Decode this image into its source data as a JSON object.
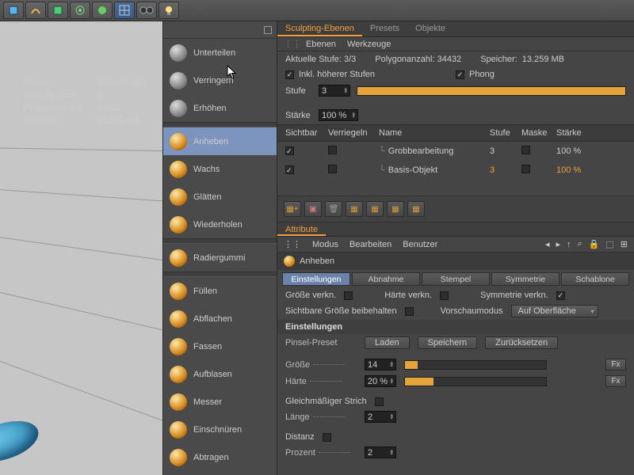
{
  "topbar_icons": [
    "cube",
    "curl",
    "cube2",
    "atom",
    "bulb-g",
    "grid",
    "goggles",
    "bulb"
  ],
  "viewport_info": {
    "rows": [
      {
        "k": "Ebene",
        "v": "Basis-Objekt"
      },
      {
        "k": "Aktuelle Stufe",
        "v": "3"
      },
      {
        "k": "Polygonanzahl",
        "v": "34432"
      },
      {
        "k": "Speicher",
        "v": "13.259 MB"
      }
    ]
  },
  "palette": {
    "groups": [
      [
        {
          "label": "Unterteilen",
          "icon": "gray"
        },
        {
          "label": "Verringern",
          "icon": "gray"
        },
        {
          "label": "Erhöhen",
          "icon": "gray",
          "disabled": true
        }
      ],
      [
        {
          "label": "Anheben",
          "selected": true
        },
        {
          "label": "Wachs"
        },
        {
          "label": "Glätten"
        },
        {
          "label": "Wiederholen"
        }
      ],
      [
        {
          "label": "Radiergummi"
        }
      ],
      [
        {
          "label": "Füllen"
        },
        {
          "label": "Abflachen"
        },
        {
          "label": "Fassen"
        },
        {
          "label": "Aufblasen"
        },
        {
          "label": "Messer"
        },
        {
          "label": "Einschnüren"
        },
        {
          "label": "Abtragen"
        }
      ]
    ]
  },
  "sculpt": {
    "tabs": [
      "Sculpting-Ebenen",
      "Presets",
      "Objekte"
    ],
    "subtabs": [
      "Ebenen",
      "Werkzeuge"
    ],
    "status": {
      "level_label": "Aktuelle Stufe:",
      "level": "3/3",
      "poly_label": "Polygonanzahl:",
      "poly": "34432",
      "mem_label": "Speicher:",
      "mem": "13.259 MB"
    },
    "incl_label": "Inkl. höherer Stufen",
    "incl": true,
    "phong_label": "Phong",
    "phong": true,
    "stufe_label": "Stufe",
    "stufe": "3",
    "staerke_label": "Stärke",
    "staerke": "100 %",
    "cols": {
      "vis": "Sichtbar",
      "lock": "Verriegeln",
      "name": "Name",
      "lvl": "Stufe",
      "mask": "Maske",
      "str": "Stärke"
    },
    "rows": [
      {
        "vis": true,
        "lock": false,
        "name": "Grobbearbeitung",
        "lvl": "3",
        "mask": false,
        "str": "100 %",
        "hl": false
      },
      {
        "vis": true,
        "lock": false,
        "name": "Basis-Objekt",
        "lvl": "3",
        "mask": false,
        "str": "100 %",
        "hl": true
      }
    ]
  },
  "attr": {
    "tab": "Attribute",
    "menus": [
      "Modus",
      "Bearbeiten",
      "Benutzer"
    ],
    "tool": "Anheben",
    "pbtns": [
      "Einstellungen",
      "Abnahme",
      "Stempel",
      "Symmetrie",
      "Schablone"
    ],
    "row1": {
      "a": "Größe verkn.",
      "b": "Härte verkn.",
      "c": "Symmetrie verkn."
    },
    "row2": {
      "a": "Sichtbare Größe beibehalten",
      "b": "Vorschaumodus",
      "dd": "Auf Oberfläche"
    },
    "sect": "Einstellungen",
    "preset_label": "Pinsel-Preset",
    "preset_btns": [
      "Laden",
      "Speichern",
      "Zurücksetzen"
    ],
    "size_label": "Größe",
    "size": "14",
    "hard_label": "Härte",
    "hard": "20 %",
    "stroke_label": "Gleichmäßiger Strich",
    "len_label": "Länge",
    "len": "2",
    "dist_label": "Distanz",
    "pct_label": "Prozent",
    "pct": "2",
    "fx": "Fx"
  }
}
